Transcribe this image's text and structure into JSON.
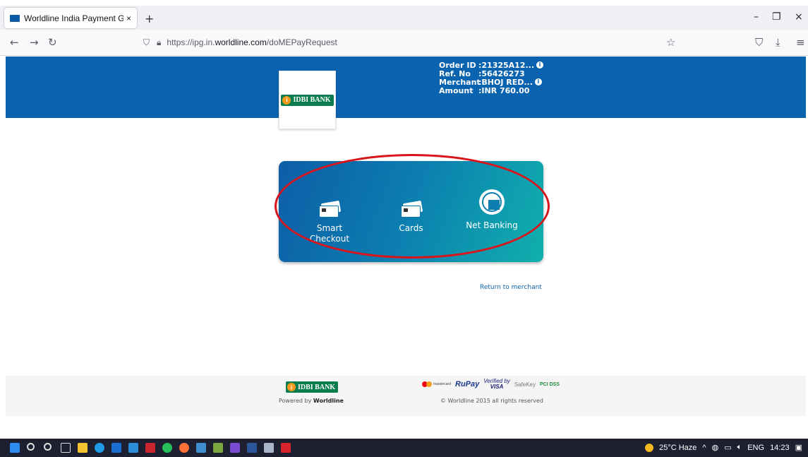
{
  "browser": {
    "tab_title": "Worldline India Payment Gatew",
    "tab_close": "×",
    "new_tab": "+",
    "url_prefix": "https://ipg.in.",
    "url_host": "worldline.com",
    "url_path": "/doMEPayRequest",
    "window_min": "–",
    "window_restore": "❐",
    "window_close": "×"
  },
  "header": {
    "bank_name": "IDBI BANK",
    "order_id_label": "Order ID",
    "order_id_value": ":21325A12...",
    "ref_label": "Ref. No",
    "ref_value": ":56426273",
    "merchant_label": "Merchant",
    "merchant_value": ":BHOJ RED...",
    "amount_label": "Amount",
    "amount_value": ":INR 760.00"
  },
  "payment_options": [
    {
      "label": "Smart\nCheckout",
      "icon": "card-icon"
    },
    {
      "label": "Cards",
      "icon": "card-icon"
    },
    {
      "label": "Net Banking",
      "icon": "globe-bank-icon"
    }
  ],
  "return_link": "Return to merchant",
  "footer": {
    "bank_name": "IDBI BANK",
    "powered_prefix": "Powered by",
    "powered_brand": "Worldline",
    "mastercard": "mastercard",
    "rupay": "RuPay",
    "vbv_line1": "Verified by",
    "vbv_line2": "VISA",
    "safekey": "SafeKey",
    "pcidss": "PCI DSS",
    "copyright": "© Worldline 2015 all rights reserved"
  },
  "taskbar": {
    "weather": "25°C  Haze",
    "language": "ENG",
    "time": "14:23"
  },
  "colors": {
    "header_blue": "#0a63ae",
    "card_gradient_start": "#0d5ea7",
    "card_gradient_end": "#10b0ad",
    "annotation_red": "#d9141a"
  }
}
